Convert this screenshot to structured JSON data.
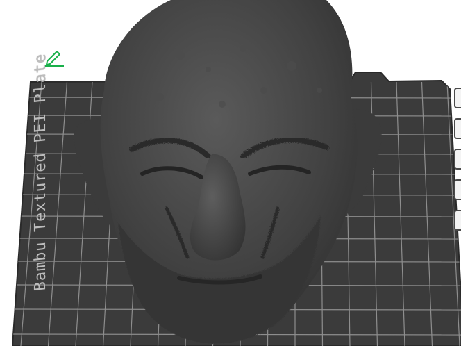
{
  "plate": {
    "label": "Bambu Textured PEI Plate"
  },
  "icons": {
    "edit": "edit-pencil-icon",
    "toolbar": [
      "view-icon",
      "orient-icon",
      "layers-icon",
      "measure-icon",
      "settings-icon"
    ]
  },
  "colors": {
    "plate": "#3b3b3b",
    "grid": "#8f8f8f",
    "model": "#454545",
    "accent": "#19b04a"
  }
}
